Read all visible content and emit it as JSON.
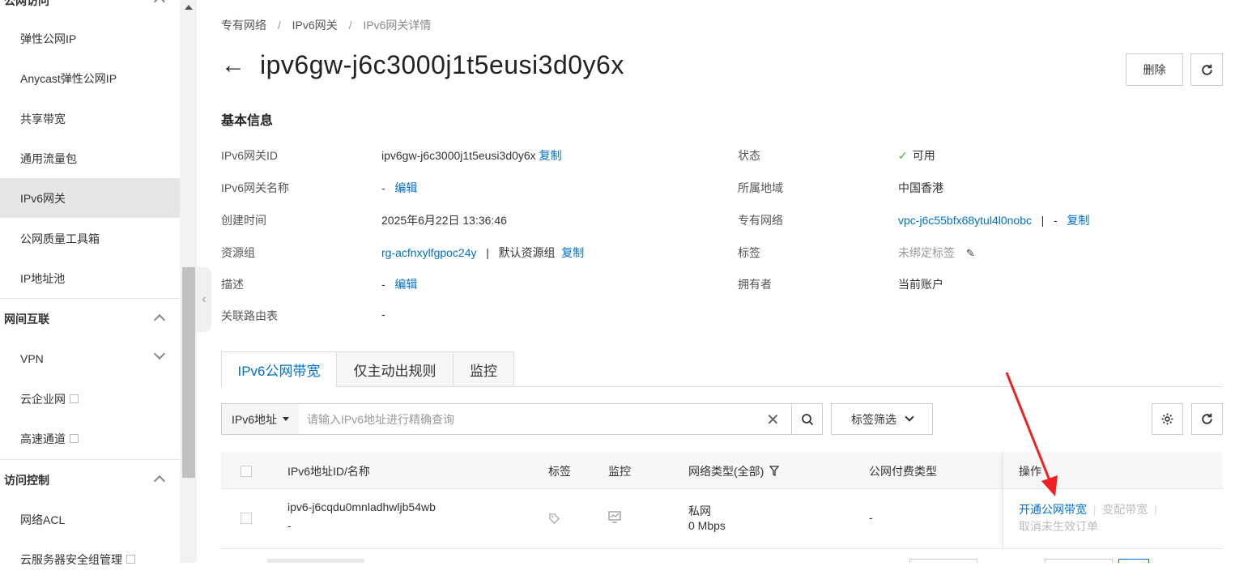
{
  "sidebar": {
    "top_group": "公网访问",
    "items_a": [
      {
        "label": "弹性公网IP"
      },
      {
        "label": "Anycast弹性公网IP"
      },
      {
        "label": "共享带宽"
      },
      {
        "label": "通用流量包"
      },
      {
        "label": "IPv6网关"
      },
      {
        "label": "公网质量工具箱"
      },
      {
        "label": "IP地址池"
      }
    ],
    "group_b": "网间互联",
    "items_b": [
      {
        "label": "VPN"
      },
      {
        "label": "云企业网"
      },
      {
        "label": "高速通道"
      }
    ],
    "group_c": "访问控制",
    "items_c": [
      {
        "label": "网络ACL"
      },
      {
        "label": "云服务器安全组管理"
      }
    ]
  },
  "breadcrumb": {
    "a": "专有网络",
    "b": "IPv6网关",
    "c": "IPv6网关详情",
    "sep": "/"
  },
  "page": {
    "title": "ipv6gw-j6c3000j1t5eusi3d0y6x",
    "back": "←"
  },
  "actions": {
    "delete": "删除"
  },
  "basic": {
    "title": "基本信息",
    "left": [
      {
        "label": "IPv6网关ID",
        "value": "ipv6gw-j6c3000j1t5eusi3d0y6x",
        "link": "复制"
      },
      {
        "label": "IPv6网关名称",
        "value": "-",
        "link": "编辑"
      },
      {
        "label": "创建时间",
        "value": "2025年6月22日 13:36:46"
      },
      {
        "label": "资源组",
        "value_link": "rg-acfnxylfgpoc24y",
        "sep": "|",
        "value2": "默认资源组",
        "link": "复制"
      },
      {
        "label": "描述",
        "value": "-",
        "link": "编辑"
      },
      {
        "label": "关联路由表",
        "value": "-"
      }
    ],
    "right": [
      {
        "label": "状态",
        "value": "可用"
      },
      {
        "label": "所属地域",
        "value": "中国香港"
      },
      {
        "label": "专有网络",
        "value_link": "vpc-j6c55bfx68ytul4l0nobc",
        "sep": "|",
        "value2": "-",
        "link": "复制"
      },
      {
        "label": "标签",
        "value": "未绑定标签"
      },
      {
        "label": "拥有者",
        "value": "当前账户"
      }
    ]
  },
  "tabs": [
    "IPv6公网带宽",
    "仅主动出规则",
    "监控"
  ],
  "toolbar": {
    "select": "IPv6地址",
    "placeholder": "请输入IPv6地址进行精确查询",
    "tag_filter": "标签筛选"
  },
  "table": {
    "headers": {
      "id": "IPv6地址ID/名称",
      "tag": "标签",
      "monitor": "监控",
      "net": "网络类型(全部)",
      "pay": "公网付费类型",
      "ops": "操作"
    },
    "rows": [
      {
        "id": "ipv6-j6cqdu0mnladhwljb54wb",
        "name": "-",
        "net_type": "私网",
        "bandwidth": "0 Mbps",
        "pay": "-",
        "op1": "开通公网带宽",
        "op2": "变配带宽",
        "op3": "取消未生效订单"
      }
    ]
  },
  "colors": {
    "link": "#0070cc",
    "active_nav": "#e6e6e6",
    "arrow": "#f02020",
    "success": "#2eb82e"
  }
}
